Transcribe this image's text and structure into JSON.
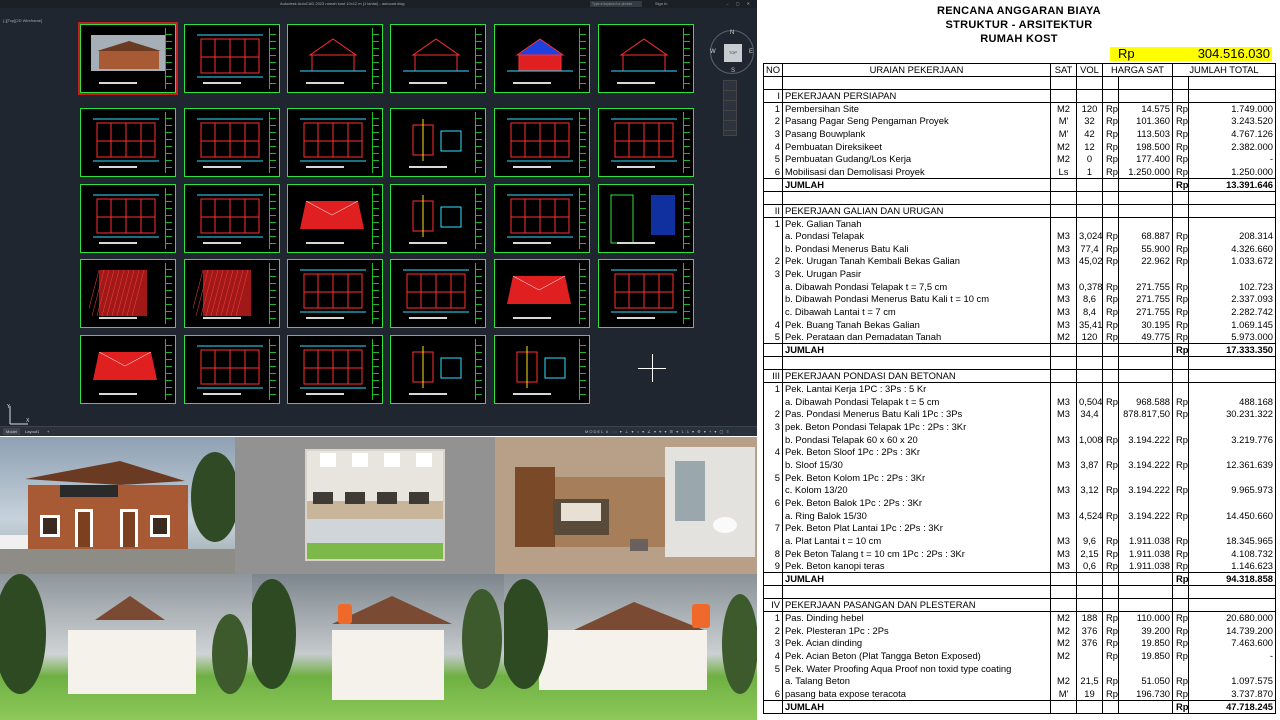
{
  "cad": {
    "app_title": "Autodesk AutoCAD 2023   rumah kost 10x12 m (1 lantai) - autocad.dwg",
    "view_label": "[-][Top][2D Wireframe]",
    "search_placeholder": "Type a keyword or phrase",
    "sign_in": "Sign In",
    "window_controls": "– ▢ ✕",
    "viewcube": {
      "top": "TOP",
      "n": "N",
      "s": "S",
      "w": "W",
      "e": "E"
    },
    "tabs": [
      "Model",
      "Layout1",
      "+"
    ],
    "status_model": "MODEL",
    "status_icons": "# ::: ▾ ⊥ ▾ ○ ▾ ∠ ▾ ⌖ ▾ ☰ ▾ 1:1 ▾ ⚙ ▾ + ▾ ▢ ≡"
  },
  "rab": {
    "title1": "RENCANA ANGGARAN BIAYA",
    "title2": "STRUKTUR - ARSITEKTUR",
    "title3": "RUMAH KOST",
    "grand_total_rp": "Rp",
    "grand_total": "304.516.030",
    "headers": [
      "NO",
      "URAIAN PEKERJAAN",
      "SAT",
      "VOL",
      "HARGA SAT",
      "JUMLAH TOTAL"
    ],
    "rows": [
      {
        "t": "gap"
      },
      {
        "t": "sec",
        "no": "I",
        "desc": "PEKERJAAN PERSIAPAN"
      },
      {
        "t": "item",
        "no": "1",
        "desc": "Pembersihan Site",
        "sat": "M2",
        "vol": "120",
        "rp1": "Rp",
        "price": "14.575",
        "rp2": "Rp",
        "total": "1.749.000"
      },
      {
        "t": "item",
        "no": "2",
        "desc": "Pasang Pagar Seng Pengaman Proyek",
        "sat": "M'",
        "vol": "32",
        "rp1": "Rp",
        "price": "101.360",
        "rp2": "Rp",
        "total": "3.243.520"
      },
      {
        "t": "item",
        "no": "3",
        "desc": "Pasang Bouwplank",
        "sat": "M'",
        "vol": "42",
        "rp1": "Rp",
        "price": "113.503",
        "rp2": "Rp",
        "total": "4.767.126"
      },
      {
        "t": "item",
        "no": "4",
        "desc": "Pembuatan Direksikeet",
        "sat": "M2",
        "vol": "12",
        "rp1": "Rp",
        "price": "198.500",
        "rp2": "Rp",
        "total": "2.382.000"
      },
      {
        "t": "item",
        "no": "5",
        "desc": "Pembuatan Gudang/Los Kerja",
        "sat": "M2",
        "vol": "0",
        "rp1": "Rp",
        "price": "177.400",
        "rp2": "Rp",
        "total": "-"
      },
      {
        "t": "item",
        "no": "6",
        "desc": "Mobilisasi dan Demolisasi Proyek",
        "sat": "Ls",
        "vol": "1",
        "rp1": "Rp",
        "price": "1.250.000",
        "rp2": "Rp",
        "total": "1.250.000"
      },
      {
        "t": "sum",
        "desc": "JUMLAH",
        "rp2": "Rp",
        "total": "13.391.646"
      },
      {
        "t": "gap"
      },
      {
        "t": "sec",
        "no": "II",
        "desc": "PEKERJAAN GALIAN DAN URUGAN"
      },
      {
        "t": "item",
        "no": "1",
        "desc": "Pek. Galian Tanah"
      },
      {
        "t": "item",
        "desc": "a. Pondasi Telapak",
        "sat": "M3",
        "vol": "3,024",
        "rp1": "Rp",
        "price": "68.887",
        "rp2": "Rp",
        "total": "208.314"
      },
      {
        "t": "item",
        "desc": "b. Pondasi Menerus Batu Kali",
        "sat": "M3",
        "vol": "77,4",
        "rp1": "Rp",
        "price": "55.900",
        "rp2": "Rp",
        "total": "4.326.660"
      },
      {
        "t": "item",
        "no": "2",
        "desc": "Pek. Urugan Tanah Kembali Bekas Galian",
        "sat": "M3",
        "vol": "45,02",
        "rp1": "Rp",
        "price": "22.962",
        "rp2": "Rp",
        "total": "1.033.672"
      },
      {
        "t": "item",
        "no": "3",
        "desc": "Pek. Urugan Pasir"
      },
      {
        "t": "item",
        "desc": "a. Dibawah Pondasi Telapak t = 7,5 cm",
        "sat": "M3",
        "vol": "0,378",
        "rp1": "Rp",
        "price": "271.755",
        "rp2": "Rp",
        "total": "102.723"
      },
      {
        "t": "item",
        "desc": "b. Dibawah Pondasi Menerus Batu Kali t = 10 cm",
        "sat": "M3",
        "vol": "8,6",
        "rp1": "Rp",
        "price": "271.755",
        "rp2": "Rp",
        "total": "2.337.093"
      },
      {
        "t": "item",
        "desc": "c. Dibawah Lantai t = 7 cm",
        "sat": "M3",
        "vol": "8,4",
        "rp1": "Rp",
        "price": "271.755",
        "rp2": "Rp",
        "total": "2.282.742"
      },
      {
        "t": "item",
        "no": "4",
        "desc": "Pek. Buang Tanah Bekas Galian",
        "sat": "M3",
        "vol": "35,41",
        "rp1": "Rp",
        "price": "30.195",
        "rp2": "Rp",
        "total": "1.069.145"
      },
      {
        "t": "item",
        "no": "5",
        "desc": "Pek. Perataan dan Pemadatan Tanah",
        "sat": "M2",
        "vol": "120",
        "rp1": "Rp",
        "price": "49.775",
        "rp2": "Rp",
        "total": "5.973.000"
      },
      {
        "t": "sum",
        "desc": "JUMLAH",
        "rp2": "Rp",
        "total": "17.333.350"
      },
      {
        "t": "gap"
      },
      {
        "t": "sec",
        "no": "III",
        "desc": "PEKERJAAN PONDASI DAN BETONAN"
      },
      {
        "t": "item",
        "no": "1",
        "desc": "Pek. Lantai Kerja 1PC : 3Ps : 5 Kr"
      },
      {
        "t": "item",
        "desc": "a. Dibawah Pondasi Telapak t = 5 cm",
        "sat": "M3",
        "vol": "0,504",
        "rp1": "Rp",
        "price": "968.588",
        "rp2": "Rp",
        "total": "488.168"
      },
      {
        "t": "item",
        "no": "2",
        "desc": "Pas. Pondasi Menerus Batu Kali 1Pc : 3Ps",
        "sat": "M3",
        "vol": "34,4",
        "rp1": "",
        "price": "878.817,50",
        "rp2": "Rp",
        "total": "30.231.322"
      },
      {
        "t": "item",
        "no": "3",
        "desc": "pek. Beton Pondasi Telapak 1Pc : 2Ps : 3Kr"
      },
      {
        "t": "item",
        "desc": "b. Pondasi Telapak 60 x 60 x 20",
        "sat": "M3",
        "vol": "1,008",
        "rp1": "Rp",
        "price": "3.194.222",
        "rp2": "Rp",
        "total": "3.219.776"
      },
      {
        "t": "item",
        "no": "4",
        "desc": "Pek. Beton Sloof 1Pc : 2Ps : 3Kr"
      },
      {
        "t": "item",
        "desc": "b. Sloof 15/30",
        "sat": "M3",
        "vol": "3,87",
        "rp1": "Rp",
        "price": "3.194.222",
        "rp2": "Rp",
        "total": "12.361.639"
      },
      {
        "t": "item",
        "no": "5",
        "desc": "Pek. Beton Kolom 1Pc : 2Ps : 3Kr"
      },
      {
        "t": "item",
        "desc": "c. Kolom 13/20",
        "sat": "M3",
        "vol": "3,12",
        "rp1": "Rp",
        "price": "3.194.222",
        "rp2": "Rp",
        "total": "9.965.973"
      },
      {
        "t": "item",
        "no": "6",
        "desc": "Pek. Beton Balok 1Pc : 2Ps : 3Kr"
      },
      {
        "t": "item",
        "desc": "a. Ring Balok 15/30",
        "sat": "M3",
        "vol": "4,524",
        "rp1": "Rp",
        "price": "3.194.222",
        "rp2": "Rp",
        "total": "14.450.660"
      },
      {
        "t": "item",
        "no": "7",
        "desc": "Pek. Beton Plat Lantai 1Pc : 2Ps : 3Kr"
      },
      {
        "t": "item",
        "desc": "a. Plat Lantai t = 10 cm",
        "sat": "M3",
        "vol": "9,6",
        "rp1": "Rp",
        "price": "1.911.038",
        "rp2": "Rp",
        "total": "18.345.965"
      },
      {
        "t": "item",
        "no": "8",
        "desc": "Pek Beton Talang t = 10 cm 1Pc : 2Ps : 3Kr",
        "sat": "M3",
        "vol": "2,15",
        "rp1": "Rp",
        "price": "1.911.038",
        "rp2": "Rp",
        "total": "4.108.732"
      },
      {
        "t": "item",
        "no": "9",
        "desc": "Pek. Beton kanopi teras",
        "sat": "M3",
        "vol": "0,6",
        "rp1": "Rp",
        "price": "1.911.038",
        "rp2": "Rp",
        "total": "1.146.623"
      },
      {
        "t": "sum",
        "desc": "JUMLAH",
        "rp2": "Rp",
        "total": "94.318.858"
      },
      {
        "t": "gap"
      },
      {
        "t": "sec",
        "no": "IV",
        "desc": "PEKERJAAN PASANGAN DAN PLESTERAN"
      },
      {
        "t": "item",
        "no": "1",
        "desc": "Pas. Dinding hebel",
        "sat": "M2",
        "vol": "188",
        "rp1": "Rp",
        "price": "110.000",
        "rp2": "Rp",
        "total": "20.680.000"
      },
      {
        "t": "item",
        "no": "2",
        "desc": "Pek. Plesteran 1Pc : 2Ps",
        "sat": "M2",
        "vol": "376",
        "rp1": "Rp",
        "price": "39.200",
        "rp2": "Rp",
        "total": "14.739.200"
      },
      {
        "t": "item",
        "no": "3",
        "desc": "Pek. Acian dinding",
        "sat": "M2",
        "vol": "376",
        "rp1": "Rp",
        "price": "19.850",
        "rp2": "Rp",
        "total": "7.463.600"
      },
      {
        "t": "item",
        "no": "4",
        "desc": "Pek. Acian Beton (Plat Tangga Beton Exposed)",
        "sat": "M2",
        "vol": "",
        "rp1": "Rp",
        "price": "19.850",
        "rp2": "Rp",
        "total": "-"
      },
      {
        "t": "item",
        "no": "5",
        "desc": "Pek. Water Proofing Aqua Proof non toxid type coating"
      },
      {
        "t": "item",
        "desc": "a. Talang Beton",
        "sat": "M2",
        "vol": "21,5",
        "rp1": "Rp",
        "price": "51.050",
        "rp2": "Rp",
        "total": "1.097.575"
      },
      {
        "t": "item",
        "no": "6",
        "desc": "pasang bata expose teracota",
        "sat": "M'",
        "vol": "19",
        "rp1": "Rp",
        "price": "196.730",
        "rp2": "Rp",
        "total": "3.737.870"
      },
      {
        "t": "sum",
        "desc": "JUMLAH",
        "rp2": "Rp",
        "total": "47.718.245"
      }
    ]
  }
}
